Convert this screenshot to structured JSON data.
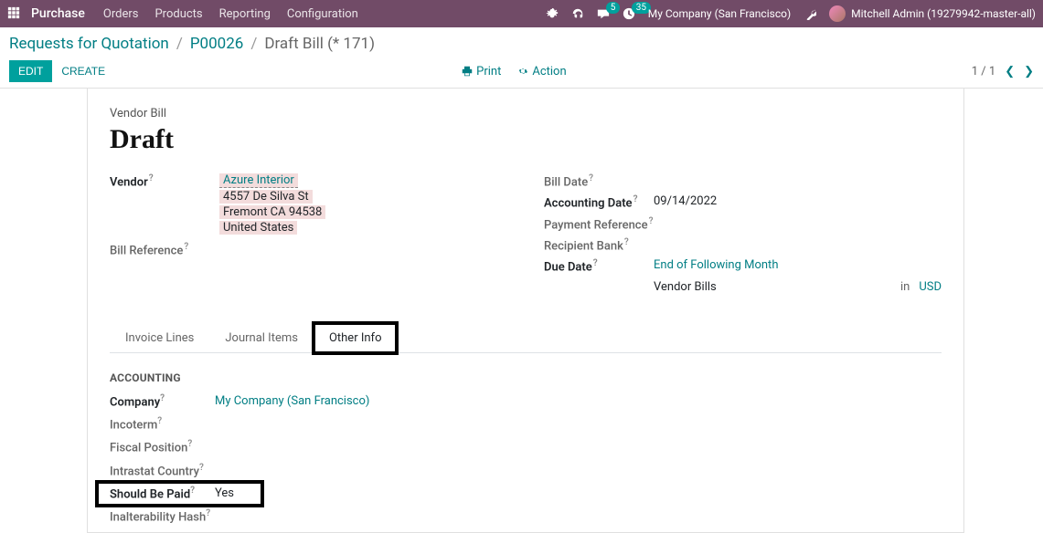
{
  "navbar": {
    "brand": "Purchase",
    "menu": [
      "Orders",
      "Products",
      "Reporting",
      "Configuration"
    ],
    "badges": {
      "messaging": "5",
      "activities": "35"
    },
    "company": "My Company (San Francisco)",
    "user": "Mitchell Admin (19279942-master-all)"
  },
  "breadcrumb": {
    "root": "Requests for Quotation",
    "l1": "P00026",
    "current": "Draft Bill (* 171)"
  },
  "buttons": {
    "edit": "EDIT",
    "create": "CREATE",
    "print": "Print",
    "action": "Action"
  },
  "pager": "1 / 1",
  "doc": {
    "type": "Vendor Bill",
    "state": "Draft",
    "vendor_label": "Vendor",
    "vendor_name": "Azure Interior",
    "vendor_addr1": "4557 De Silva St",
    "vendor_addr2": "Fremont CA 94538",
    "vendor_addr3": "United States",
    "bill_ref_label": "Bill Reference",
    "bill_date_label": "Bill Date",
    "acct_date_label": "Accounting Date",
    "acct_date": "09/14/2022",
    "pay_ref_label": "Payment Reference",
    "recip_bank_label": "Recipient Bank",
    "due_date_label": "Due Date",
    "due_date": "End of Following Month",
    "journal": "Vendor Bills",
    "journal_in": "in",
    "currency": "USD"
  },
  "tabs": {
    "t1": "Invoice Lines",
    "t2": "Journal Items",
    "t3": "Other Info"
  },
  "accounting": {
    "heading": "ACCOUNTING",
    "company_label": "Company",
    "company": "My Company (San Francisco)",
    "incoterm_label": "Incoterm",
    "fiscal_label": "Fiscal Position",
    "intrastat_label": "Intrastat Country",
    "should_be_paid_label": "Should Be Paid",
    "should_be_paid": "Yes",
    "inalter_label": "Inalterability Hash"
  }
}
